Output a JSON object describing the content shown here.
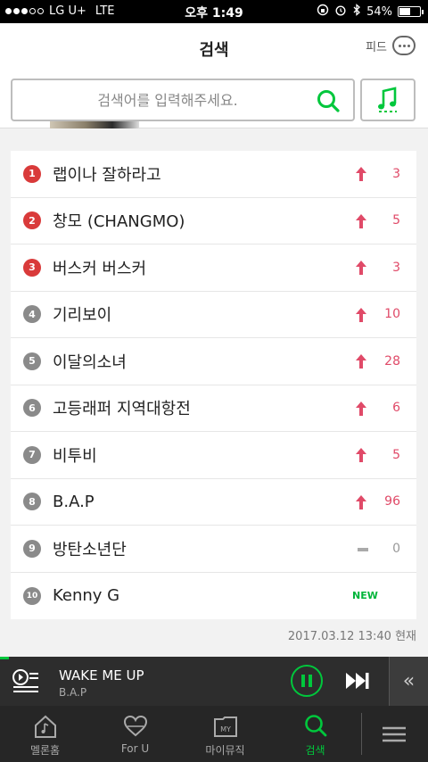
{
  "status_bar": {
    "carrier": "LG U+",
    "network": "LTE",
    "time": "오후 1:49",
    "battery": "54%",
    "battery_level": 0.54
  },
  "header": {
    "title": "검색",
    "feed_label": "피드"
  },
  "search": {
    "placeholder": "검색어를 입력해주세요."
  },
  "chart": {
    "rows": [
      {
        "rank": "1",
        "keyword": "랩이나 잘하라고",
        "trend": "up",
        "change": "3",
        "rank_color": "red"
      },
      {
        "rank": "2",
        "keyword": "창모 (CHANGMO)",
        "trend": "up",
        "change": "5",
        "rank_color": "red"
      },
      {
        "rank": "3",
        "keyword": "버스커 버스커",
        "trend": "up",
        "change": "3",
        "rank_color": "red"
      },
      {
        "rank": "4",
        "keyword": "기리보이",
        "trend": "up",
        "change": "10",
        "rank_color": "gray"
      },
      {
        "rank": "5",
        "keyword": "이달의소녀",
        "trend": "up",
        "change": "28",
        "rank_color": "gray"
      },
      {
        "rank": "6",
        "keyword": "고등래퍼 지역대항전",
        "trend": "up",
        "change": "6",
        "rank_color": "gray"
      },
      {
        "rank": "7",
        "keyword": "비투비",
        "trend": "up",
        "change": "5",
        "rank_color": "gray"
      },
      {
        "rank": "8",
        "keyword": "B.A.P",
        "trend": "up",
        "change": "96",
        "rank_color": "gray"
      },
      {
        "rank": "9",
        "keyword": "방탄소년단",
        "trend": "same",
        "change": "0",
        "rank_color": "gray"
      },
      {
        "rank": "10",
        "keyword": "Kenny G",
        "trend": "new",
        "change": "NEW",
        "rank_color": "gray"
      }
    ],
    "updated": "2017.03.12 13:40 현재"
  },
  "player": {
    "song": "WAKE ME UP",
    "artist": "B.A.P",
    "accent_color": "#00c73c"
  },
  "tabs": [
    {
      "label": "멜론홈",
      "icon": "home-icon"
    },
    {
      "label": "For U",
      "icon": "for-u-icon"
    },
    {
      "label": "마이뮤직",
      "icon": "my-music-icon"
    },
    {
      "label": "검색",
      "icon": "search-icon"
    }
  ],
  "colors": {
    "up": "#e04a68",
    "new": "#00b53a",
    "rank_top": "#d93a3a",
    "rank_other": "#8a8a8a"
  }
}
